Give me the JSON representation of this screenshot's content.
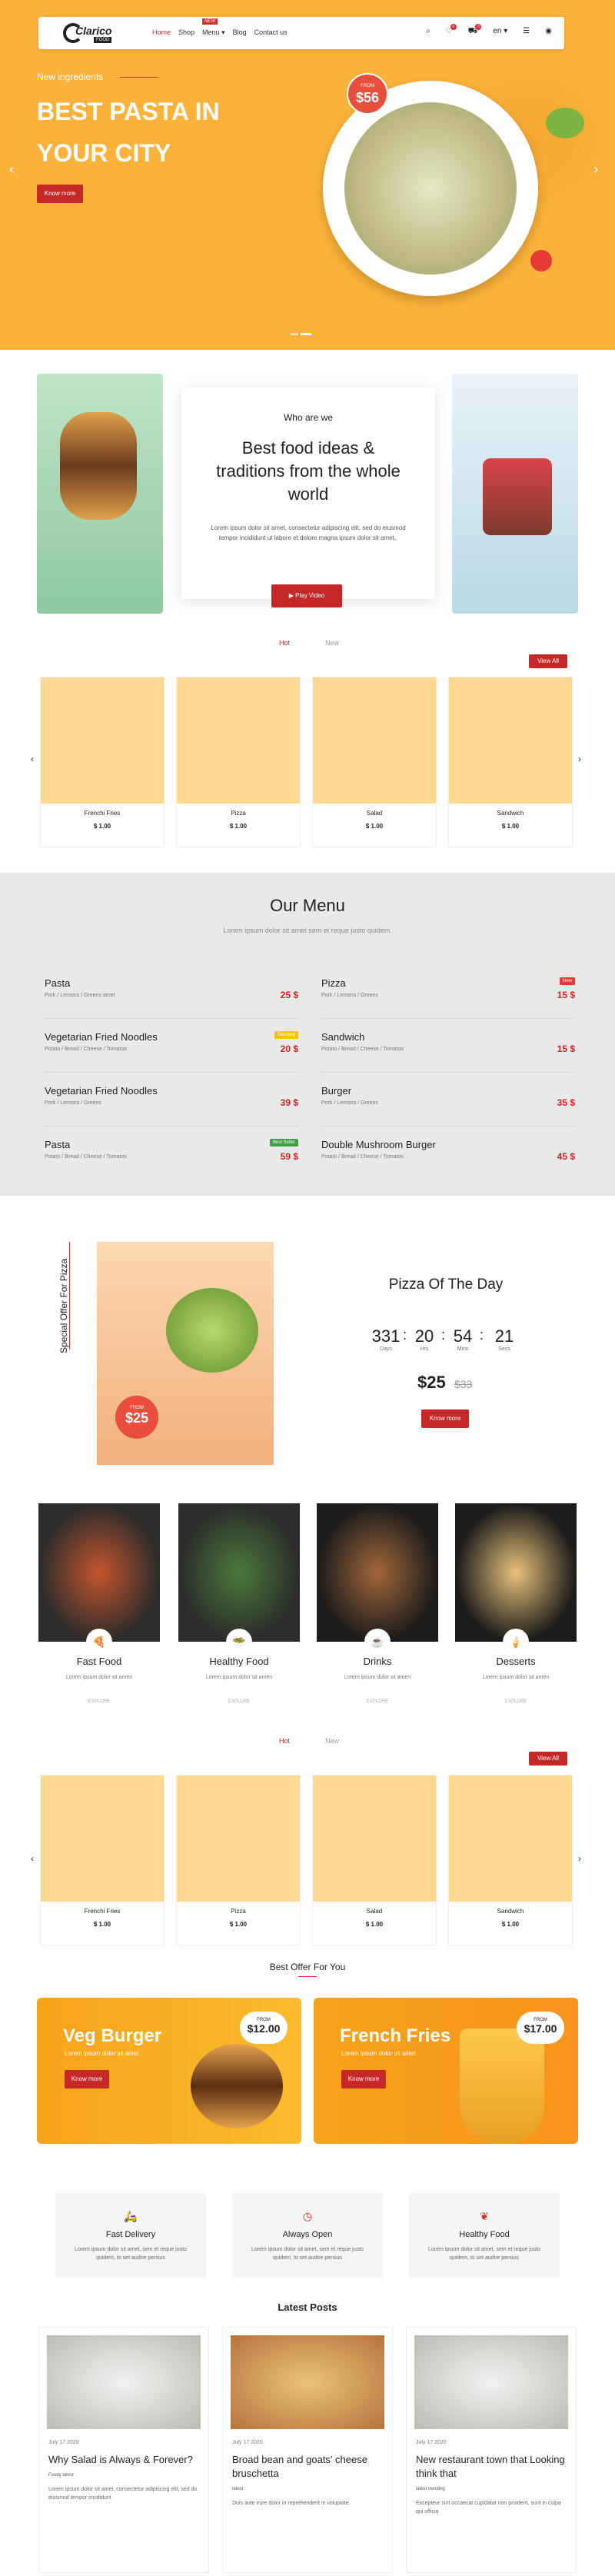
{
  "nav": {
    "brand": "Clarico",
    "brand_sub": "FOOD",
    "items": [
      "Home",
      "Shop",
      "Menu",
      "Blog",
      "Contact us"
    ],
    "new_badge": "NEW",
    "lang": "en",
    "badges": [
      "0",
      "0"
    ]
  },
  "hero": {
    "kicker": "New ingredients",
    "title": "BEST PASTA IN YOUR CITY",
    "button": "Know more",
    "price_from": "FROM",
    "price": "$56"
  },
  "about": {
    "heading": "Who are we",
    "title": "Best food ideas & traditions from the whole world",
    "text": "Lorem ipsum dolor sit amet, consectetur adipiscing elit, sed do eiusmod tempor incididunt ut labore et dolore magna ipsum dolor sit amet,.",
    "button": "Play Video"
  },
  "tabs1": {
    "hot": "Hot",
    "new": "New",
    "view_all": "View All"
  },
  "products1": [
    {
      "name": "Frenchi Fries",
      "price": "$ 1.00"
    },
    {
      "name": "Pizza",
      "price": "$ 1.00"
    },
    {
      "name": "Salad",
      "price": "$ 1.00"
    },
    {
      "name": "Sandwich",
      "price": "$ 1.00"
    }
  ],
  "menu": {
    "title": "Our Menu",
    "subtitle": "Lorem ipsum dolor sit amet sem et reque justo quidem.",
    "left": [
      {
        "name": "Pasta",
        "desc": "Pork / Lemons / Greens amet",
        "price": "25 $",
        "badge": ""
      },
      {
        "name": "Vegetarian Fried Noodles",
        "desc": "Potato / Bread / Cheese / Tomatos",
        "price": "20 $",
        "badge": "Trending"
      },
      {
        "name": "Vegetarian Fried Noodles",
        "desc": "Pork / Lemons / Greens",
        "price": "39 $",
        "badge": ""
      },
      {
        "name": "Pasta",
        "desc": "Potato / Bread / Cheese / Tomatos",
        "price": "59 $",
        "badge": "Best Seller"
      }
    ],
    "right": [
      {
        "name": "Pizza",
        "desc": "Pork / Lemons / Greens",
        "price": "15 $",
        "badge": "New"
      },
      {
        "name": "Sandwich",
        "desc": "Potato / Bread / Cheese / Tomatos",
        "price": "15 $",
        "badge": ""
      },
      {
        "name": "Burger",
        "desc": "Pork / Lemons / Greens",
        "price": "35 $",
        "badge": ""
      },
      {
        "name": "Double Mushroom Burger",
        "desc": "Potato / Bread / Cheese / Tomatos",
        "price": "45 $",
        "badge": ""
      }
    ]
  },
  "pizza_day": {
    "vertical": "Special Offer For Pizza",
    "title": "Pizza Of The Day",
    "badge_from": "FROM",
    "badge_price": "$25",
    "countdown": [
      {
        "v": "331",
        "l": "Days"
      },
      {
        "v": "20",
        "l": "Hrs"
      },
      {
        "v": "54",
        "l": "Mins"
      },
      {
        "v": "21",
        "l": "Secs"
      }
    ],
    "price": "$25",
    "old_price": "$33",
    "button": "Know more"
  },
  "categories": [
    {
      "name": "Fast Food",
      "desc": "Lorem ipsum dolor sit amen",
      "explore": "EXPLORE"
    },
    {
      "name": "Healthy Food",
      "desc": "Lorem ipsum dolor sit amen",
      "explore": "EXPLORE"
    },
    {
      "name": "Drinks",
      "desc": "Lorem ipsum dolor sit amen",
      "explore": "EXPLORE"
    },
    {
      "name": "Desserts",
      "desc": "Lorem ipsum dolor sit amen",
      "explore": "EXPLORE"
    }
  ],
  "tabs2": {
    "hot": "Hot",
    "new": "New",
    "view_all": "View All"
  },
  "products2": [
    {
      "name": "Frenchi Fries",
      "price": "$ 1.00"
    },
    {
      "name": "Pizza",
      "price": "$ 1.00"
    },
    {
      "name": "Salad",
      "price": "$ 1.00"
    },
    {
      "name": "Sandwich",
      "price": "$ 1.00"
    }
  ],
  "best_offer": {
    "title": "Best Offer For You",
    "offers": [
      {
        "title": "Veg Burger",
        "sub": "Lorem ipsum dolor sit amet",
        "button": "Know more",
        "from": "FROM",
        "price": "$12.00"
      },
      {
        "title": "French Fries",
        "sub": "Lorem ipsum dolor sit amet",
        "button": "Know more",
        "from": "FROM",
        "price": "$17.00"
      }
    ]
  },
  "features": [
    {
      "title": "Fast Delivery",
      "desc": "Lorem ipsum dolor sit amet, sem et reque justo quidem, to set audire persius"
    },
    {
      "title": "Always Open",
      "desc": "Lorem ipsum dolor sit amet, sem et reque justo quidem, to set audire persius"
    },
    {
      "title": "Healthy Food",
      "desc": "Lorem ipsum dolor sit amet, sem et reque justo quidem, to set audire persius"
    }
  ],
  "posts": {
    "title": "Latest Posts",
    "items": [
      {
        "date": "July 17 2020",
        "title": "Why Salad is Always & Forever?",
        "tags": "Foody  latest",
        "excerpt": "Lorem ipsum dolor sit amet, consectetur adipiscing elit, sed do eiusmod tempor incididunt"
      },
      {
        "date": "July 17 2020",
        "title": "Broad bean and goats' cheese bruschetta",
        "tags": "latest",
        "excerpt": "Duis aute irure dolor in reprehenderit in voluptate."
      },
      {
        "date": "July 17 2020",
        "title": "New restaurant town that Looking think that",
        "tags": "latest  trending",
        "excerpt": "Excepteur sint occaecat cupidatat non proident, sunt in culpa qui officia"
      }
    ]
  }
}
